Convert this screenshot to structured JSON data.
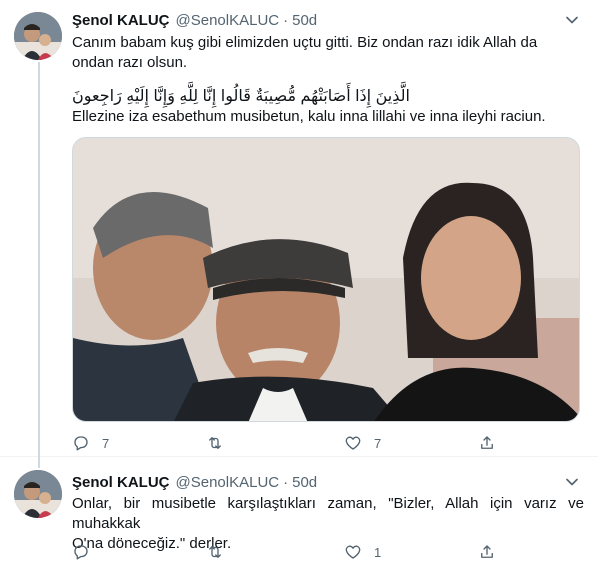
{
  "tweets": [
    {
      "author_name": "Şenol KALUÇ",
      "handle": "@SenolKALUC",
      "separator": "·",
      "time": "50d",
      "text_line1": "Canım babam kuş gibi elimizden uçtu gitti. Biz ondan razı idik Allah da",
      "text_line2": "ondan razı olsun.",
      "arabic_verse": "الَّذِينَ إِذَا أَصَابَتْهُم مُّصِيبَةٌ قَالُوا إِنَّا لِلَّهِ وَإِنَّا إِلَيْهِ رَاجِعونَ",
      "transliteration": "Ellezine iza esabethum musibetun, kalu inna lillahi ve inna ileyhi raciun.",
      "replies": "7",
      "retweets": "",
      "likes": "7"
    },
    {
      "author_name": "Şenol KALUÇ",
      "handle": "@SenolKALUC",
      "separator": "·",
      "time": "50d",
      "text_line1": "Onlar, bir musibetle karşılaştıkları zaman, \"Bizler, Allah için varız ve muhakkak",
      "text_line2": "O'na döneceğiz.\" derler.",
      "replies": "",
      "retweets": "",
      "likes": "1"
    }
  ],
  "icons": {
    "reply": "reply-icon",
    "retweet": "retweet-icon",
    "like": "heart-icon",
    "share": "share-icon",
    "more": "chevron-down-icon"
  },
  "colors": {
    "text": "#0f1419",
    "secondary": "#536471",
    "divider": "#eff3f4",
    "thread_line": "#cfd9de"
  }
}
